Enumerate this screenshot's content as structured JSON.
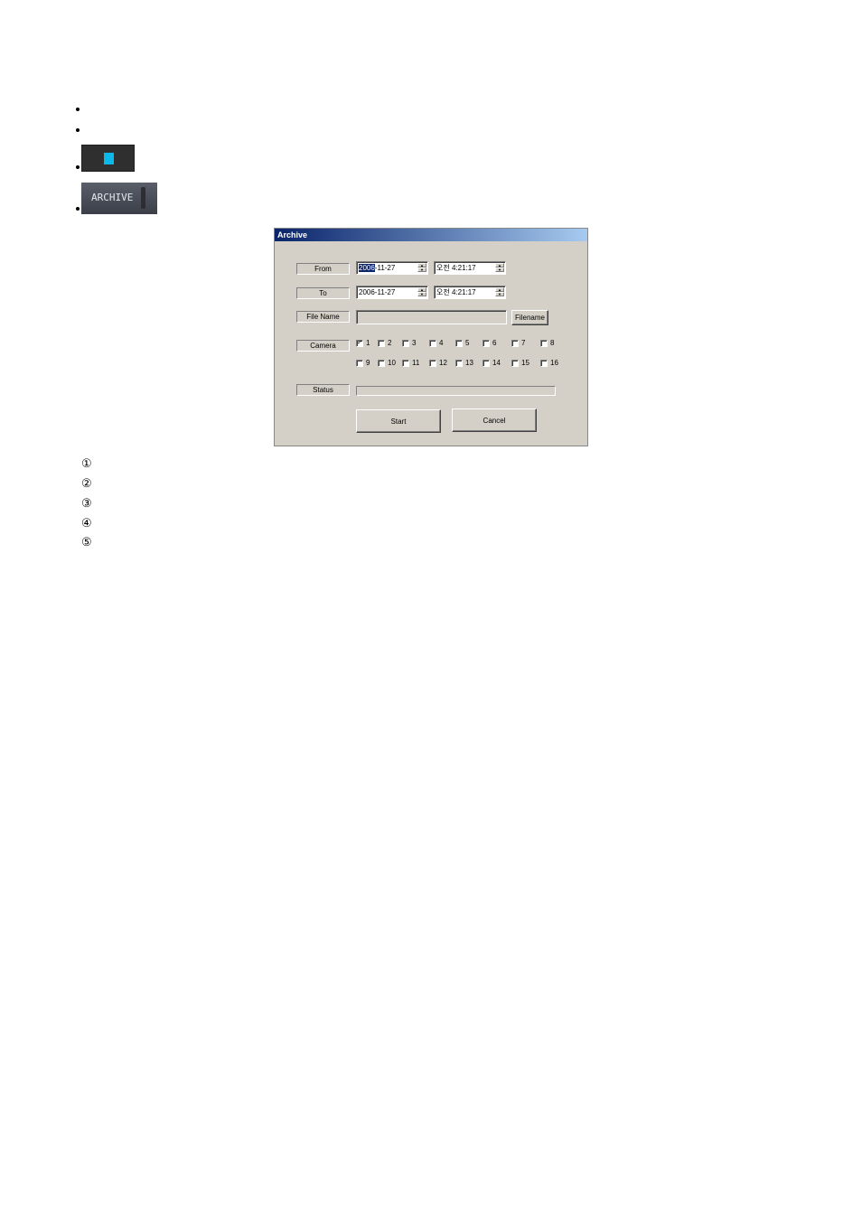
{
  "bullets": [
    {
      "type": "text",
      "text": ""
    },
    {
      "type": "text",
      "text": ""
    },
    {
      "type": "image",
      "icon": "stop-button-icon",
      "accent": "#0ab8ea"
    },
    {
      "type": "image",
      "icon": "archive-button-icon",
      "label": "ARCHIVE"
    }
  ],
  "dialog": {
    "title": "Archive",
    "from": {
      "label": "From",
      "date": "2006-11-27",
      "date_selected": "2006",
      "date_rest": "-11-27",
      "time": "오전  4:21:17"
    },
    "to": {
      "label": "To",
      "date": "2006-11-27",
      "time": "오전  4:21:17"
    },
    "file_name": {
      "label": "File Name",
      "value": "",
      "button": "Filename"
    },
    "camera": {
      "label": "Camera",
      "items": [
        {
          "num": "1",
          "checked": true
        },
        {
          "num": "2",
          "checked": false
        },
        {
          "num": "3",
          "checked": false
        },
        {
          "num": "4",
          "checked": false
        },
        {
          "num": "5",
          "checked": false
        },
        {
          "num": "6",
          "checked": false
        },
        {
          "num": "7",
          "checked": false
        },
        {
          "num": "8",
          "checked": false
        },
        {
          "num": "9",
          "checked": false
        },
        {
          "num": "10",
          "checked": false
        },
        {
          "num": "11",
          "checked": false
        },
        {
          "num": "12",
          "checked": false
        },
        {
          "num": "13",
          "checked": false
        },
        {
          "num": "14",
          "checked": false
        },
        {
          "num": "15",
          "checked": false
        },
        {
          "num": "16",
          "checked": false
        }
      ]
    },
    "status": {
      "label": "Status",
      "progress": 0
    },
    "buttons": {
      "start": "Start",
      "cancel": "Cancel"
    }
  },
  "numbered_list": [
    "①",
    "②",
    "③",
    "④",
    "⑤"
  ]
}
